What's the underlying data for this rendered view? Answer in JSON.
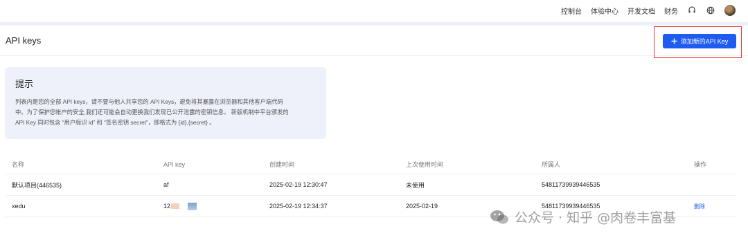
{
  "topnav": {
    "console": "控制台",
    "experience_center": "体验中心",
    "dev_docs": "开发文档",
    "finance": "财务"
  },
  "header": {
    "title": "API keys"
  },
  "actions": {
    "add_key_label": "添加新的API Key"
  },
  "tip": {
    "title": "提示",
    "lines": [
      "列表内是您的全部 API keys，请不要与他人共享您的 API Keys，避免将其暴露在浏览器和其他客户端代码",
      "中。为了保护您帐户的安全,我们还可能会自动更换我们发现已公开泄露的密钥信息。 新版机制中平台颁发的",
      "API Key 同时包含 “用户标识 id” 和 “签名密钥 secret”，即格式为 {id}.{secret} 。"
    ]
  },
  "table": {
    "columns": [
      "名称",
      "API key",
      "创建时间",
      "上次使用时间",
      "所属人",
      "操作"
    ],
    "rows": [
      {
        "name": "默认项目(446535)",
        "api_key": "af",
        "created": "2025-02-19 12:30:47",
        "last_used": "未使用",
        "owner": "54811739939446535",
        "action": ""
      },
      {
        "name": "xedu",
        "api_key": "12",
        "created": "2025-02-19 12:34:37",
        "last_used": "2025-02-19",
        "owner": "54811739939446535",
        "action": "删除"
      }
    ]
  },
  "watermark": {
    "text": "公众号 · 知乎 @肉卷丰富基"
  },
  "colors": {
    "primary": "#1e5bf0",
    "highlight_border": "#e53935",
    "tip_bg": "#eef1fa"
  },
  "icons": [
    "headset-icon",
    "globe-icon",
    "plus-icon",
    "wechat-icon"
  ]
}
